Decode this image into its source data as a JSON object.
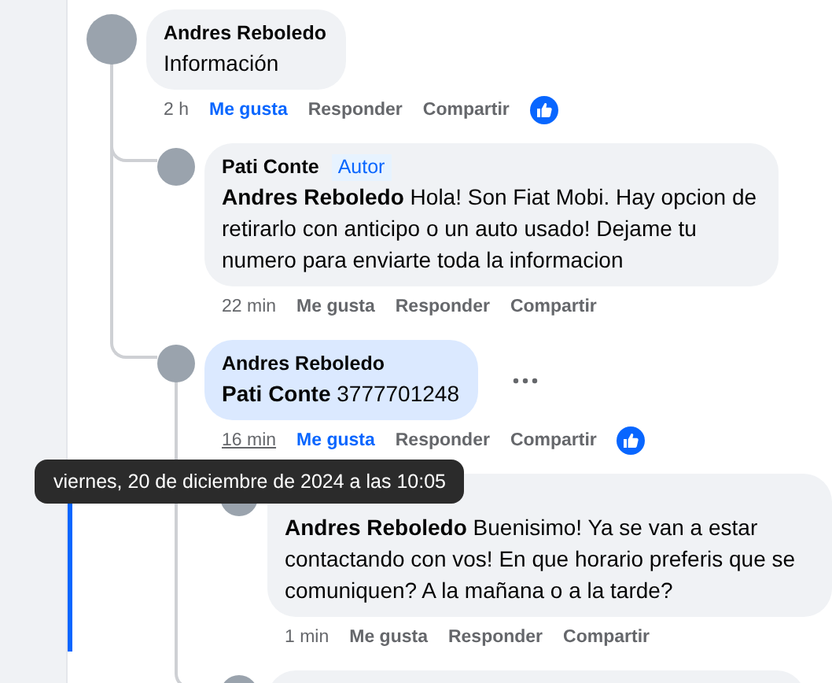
{
  "comments": [
    {
      "name": "Andres Reboledo",
      "text": "Información",
      "time": "2 h",
      "like": "Me gusta",
      "reply": "Responder",
      "share": "Compartir",
      "liked": true,
      "highlighted": false,
      "show_menu": false,
      "time_hovered": false,
      "focused": false,
      "children": [
        {
          "name": "Pati Conte",
          "badge": "Autor",
          "text": "**Andres Reboledo** Hola! Son Fiat Mobi. Hay opcion de retirarlo con anticipo o un auto usado! Dejame tu numero para enviarte toda la informacion",
          "time": "22 min",
          "like": "Me gusta",
          "reply": "Responder",
          "share": "Compartir",
          "liked": false,
          "highlighted": false,
          "show_menu": false,
          "time_hovered": false,
          "focused": false
        },
        {
          "name": "Andres Reboledo",
          "text": "**Pati Conte** 3777701248",
          "time": "16 min",
          "like": "Me gusta",
          "reply": "Responder",
          "share": "Compartir",
          "liked": true,
          "highlighted": true,
          "show_menu": true,
          "time_hovered": true,
          "focused": false,
          "tooltip": "viernes, 20 de diciembre de 2024 a las 10:05",
          "children": [
            {
              "text": "**Andres Reboledo** Buenisimo! Ya se van a estar contactando con vos! En que horario preferis que se comuniquen? A la mañana o a la tarde?",
              "time": "1 min",
              "like": "Me gusta",
              "reply": "Responder",
              "share": "Compartir",
              "liked": false,
              "highlighted": false,
              "show_menu": false,
              "time_hovered": false,
              "focused": true
            },
            {
              "highlighted": false
            }
          ]
        }
      ]
    }
  ]
}
